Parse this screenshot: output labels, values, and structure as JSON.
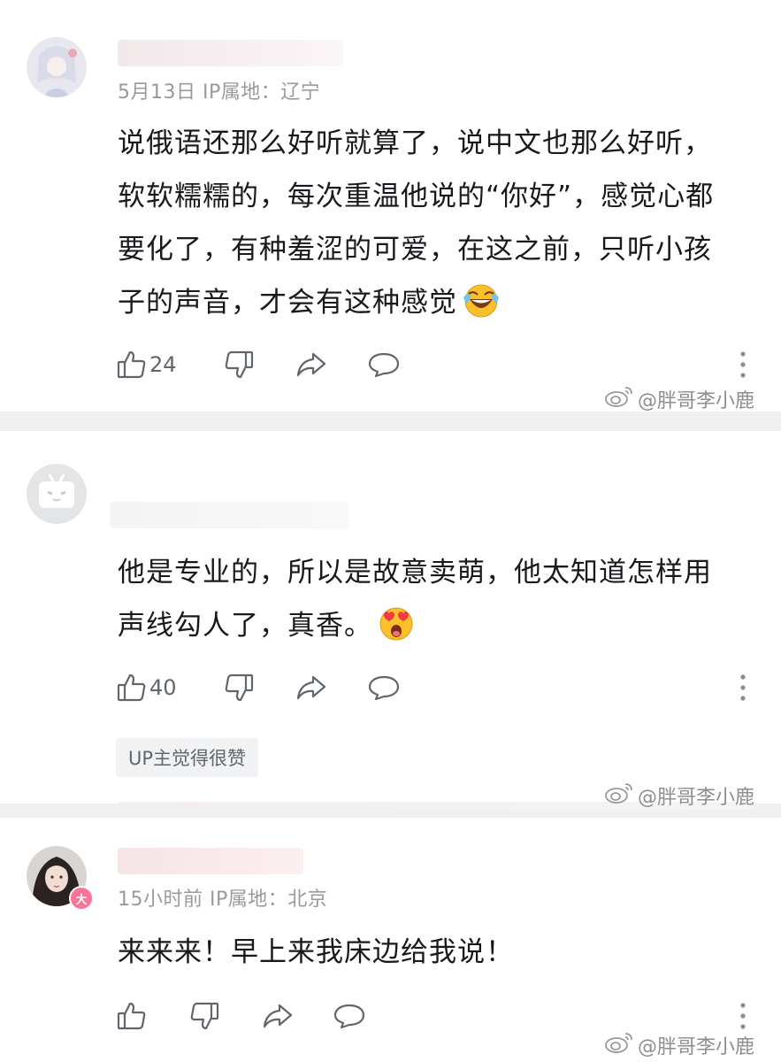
{
  "comments": [
    {
      "meta": "5月13日 IP属地：辽宁",
      "content": "说俄语还那么好听就算了，说中文也那么好听，软软糯糯的，每次重温他说的“你好”，感觉心都要化了，有种羞涩的可爱，在这之前，只听小孩子的声音，才会有这种感觉",
      "likes": "24"
    },
    {
      "meta": "",
      "content": "他是专业的，所以是故意卖萌，他太知道怎样用声线勾人了，真香。",
      "likes": "40",
      "badge": "UP主觉得很赞"
    },
    {
      "meta": "15小时前 IP属地：北京",
      "content": "来来来！早上来我床边给我说！",
      "likes": "",
      "vip_badge": "大"
    }
  ],
  "watermark": "@胖哥李小鹿",
  "icons": [
    "like-icon",
    "dislike-icon",
    "share-icon",
    "reply-icon",
    "more-icon",
    "weibo-icon"
  ],
  "colors": {
    "accent_pink": "#fb7299",
    "text": "#18191c",
    "meta": "#9a9a9e"
  }
}
